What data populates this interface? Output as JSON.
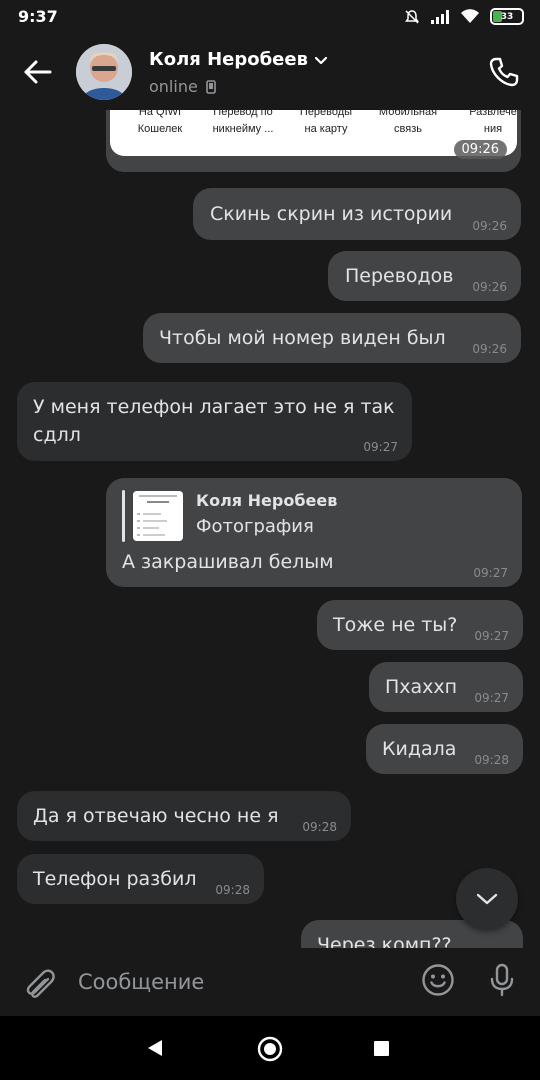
{
  "status_bar": {
    "time": "9:37",
    "battery": "33"
  },
  "header": {
    "contact_name": "Коля Неробеев",
    "status": "online"
  },
  "card": {
    "items": [
      [
        "На QIWI",
        "Кошелек"
      ],
      [
        "Перевод по",
        "никнейму ..."
      ],
      [
        "Переводы",
        "на карту"
      ],
      [
        "Мобильная",
        "связь"
      ],
      [
        "Развлече",
        "ния"
      ]
    ],
    "time": "09:26"
  },
  "messages": [
    {
      "dir": "out",
      "text": "Скинь скрин из истории",
      "time": "09:26"
    },
    {
      "dir": "out",
      "text": "Переводов",
      "time": "09:26"
    },
    {
      "dir": "out",
      "text": "Чтобы мой номер виден был",
      "time": "09:26"
    },
    {
      "dir": "in",
      "text": "У меня телефон лагает это не я так сдлл",
      "time": "09:27"
    },
    {
      "dir": "out",
      "reply_author": "Коля Неробеев",
      "reply_type": "Фотография",
      "text": "А закрашивал белым",
      "time": "09:27"
    },
    {
      "dir": "out",
      "text": "Тоже не ты?",
      "time": "09:27"
    },
    {
      "dir": "out",
      "text": "Пхаххп",
      "time": "09:27"
    },
    {
      "dir": "out",
      "text": "Кидала",
      "time": "09:28"
    },
    {
      "dir": "in",
      "text": "Да я отвечаю чесно не я",
      "time": "09:28"
    },
    {
      "dir": "in",
      "text": "Телефон разбил",
      "time": "09:28"
    },
    {
      "dir": "out",
      "text": "Через комп??",
      "time": ""
    }
  ],
  "composer": {
    "placeholder": "Сообщение"
  },
  "colors": {
    "background": "#19191a",
    "outgoing_bubble": "#434445",
    "incoming_bubble": "#2c2d2e",
    "battery_fill": "#4bb34b"
  },
  "icons": [
    "back-arrow-icon",
    "phone-icon",
    "chevron-down-icon",
    "mobile-device-icon",
    "paperclip-icon",
    "emoji-icon",
    "microphone-icon",
    "scroll-down-icon",
    "nav-back-icon",
    "nav-home-icon",
    "nav-recents-icon",
    "mute-icon",
    "signal-icon",
    "wifi-icon",
    "battery-icon"
  ]
}
